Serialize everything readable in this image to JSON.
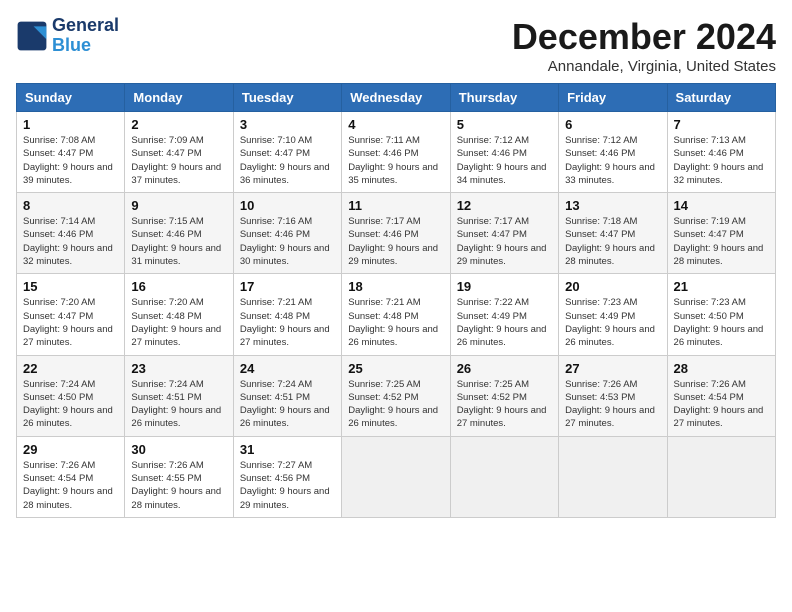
{
  "header": {
    "logo_line1": "General",
    "logo_line2": "Blue",
    "month_title": "December 2024",
    "location": "Annandale, Virginia, United States"
  },
  "days_of_week": [
    "Sunday",
    "Monday",
    "Tuesday",
    "Wednesday",
    "Thursday",
    "Friday",
    "Saturday"
  ],
  "weeks": [
    [
      {
        "day": "1",
        "sunrise": "7:08 AM",
        "sunset": "4:47 PM",
        "daylight": "9 hours and 39 minutes."
      },
      {
        "day": "2",
        "sunrise": "7:09 AM",
        "sunset": "4:47 PM",
        "daylight": "9 hours and 37 minutes."
      },
      {
        "day": "3",
        "sunrise": "7:10 AM",
        "sunset": "4:47 PM",
        "daylight": "9 hours and 36 minutes."
      },
      {
        "day": "4",
        "sunrise": "7:11 AM",
        "sunset": "4:46 PM",
        "daylight": "9 hours and 35 minutes."
      },
      {
        "day": "5",
        "sunrise": "7:12 AM",
        "sunset": "4:46 PM",
        "daylight": "9 hours and 34 minutes."
      },
      {
        "day": "6",
        "sunrise": "7:12 AM",
        "sunset": "4:46 PM",
        "daylight": "9 hours and 33 minutes."
      },
      {
        "day": "7",
        "sunrise": "7:13 AM",
        "sunset": "4:46 PM",
        "daylight": "9 hours and 32 minutes."
      }
    ],
    [
      {
        "day": "8",
        "sunrise": "7:14 AM",
        "sunset": "4:46 PM",
        "daylight": "9 hours and 32 minutes."
      },
      {
        "day": "9",
        "sunrise": "7:15 AM",
        "sunset": "4:46 PM",
        "daylight": "9 hours and 31 minutes."
      },
      {
        "day": "10",
        "sunrise": "7:16 AM",
        "sunset": "4:46 PM",
        "daylight": "9 hours and 30 minutes."
      },
      {
        "day": "11",
        "sunrise": "7:17 AM",
        "sunset": "4:46 PM",
        "daylight": "9 hours and 29 minutes."
      },
      {
        "day": "12",
        "sunrise": "7:17 AM",
        "sunset": "4:47 PM",
        "daylight": "9 hours and 29 minutes."
      },
      {
        "day": "13",
        "sunrise": "7:18 AM",
        "sunset": "4:47 PM",
        "daylight": "9 hours and 28 minutes."
      },
      {
        "day": "14",
        "sunrise": "7:19 AM",
        "sunset": "4:47 PM",
        "daylight": "9 hours and 28 minutes."
      }
    ],
    [
      {
        "day": "15",
        "sunrise": "7:20 AM",
        "sunset": "4:47 PM",
        "daylight": "9 hours and 27 minutes."
      },
      {
        "day": "16",
        "sunrise": "7:20 AM",
        "sunset": "4:48 PM",
        "daylight": "9 hours and 27 minutes."
      },
      {
        "day": "17",
        "sunrise": "7:21 AM",
        "sunset": "4:48 PM",
        "daylight": "9 hours and 27 minutes."
      },
      {
        "day": "18",
        "sunrise": "7:21 AM",
        "sunset": "4:48 PM",
        "daylight": "9 hours and 26 minutes."
      },
      {
        "day": "19",
        "sunrise": "7:22 AM",
        "sunset": "4:49 PM",
        "daylight": "9 hours and 26 minutes."
      },
      {
        "day": "20",
        "sunrise": "7:23 AM",
        "sunset": "4:49 PM",
        "daylight": "9 hours and 26 minutes."
      },
      {
        "day": "21",
        "sunrise": "7:23 AM",
        "sunset": "4:50 PM",
        "daylight": "9 hours and 26 minutes."
      }
    ],
    [
      {
        "day": "22",
        "sunrise": "7:24 AM",
        "sunset": "4:50 PM",
        "daylight": "9 hours and 26 minutes."
      },
      {
        "day": "23",
        "sunrise": "7:24 AM",
        "sunset": "4:51 PM",
        "daylight": "9 hours and 26 minutes."
      },
      {
        "day": "24",
        "sunrise": "7:24 AM",
        "sunset": "4:51 PM",
        "daylight": "9 hours and 26 minutes."
      },
      {
        "day": "25",
        "sunrise": "7:25 AM",
        "sunset": "4:52 PM",
        "daylight": "9 hours and 26 minutes."
      },
      {
        "day": "26",
        "sunrise": "7:25 AM",
        "sunset": "4:52 PM",
        "daylight": "9 hours and 27 minutes."
      },
      {
        "day": "27",
        "sunrise": "7:26 AM",
        "sunset": "4:53 PM",
        "daylight": "9 hours and 27 minutes."
      },
      {
        "day": "28",
        "sunrise": "7:26 AM",
        "sunset": "4:54 PM",
        "daylight": "9 hours and 27 minutes."
      }
    ],
    [
      {
        "day": "29",
        "sunrise": "7:26 AM",
        "sunset": "4:54 PM",
        "daylight": "9 hours and 28 minutes."
      },
      {
        "day": "30",
        "sunrise": "7:26 AM",
        "sunset": "4:55 PM",
        "daylight": "9 hours and 28 minutes."
      },
      {
        "day": "31",
        "sunrise": "7:27 AM",
        "sunset": "4:56 PM",
        "daylight": "9 hours and 29 minutes."
      },
      null,
      null,
      null,
      null
    ]
  ]
}
